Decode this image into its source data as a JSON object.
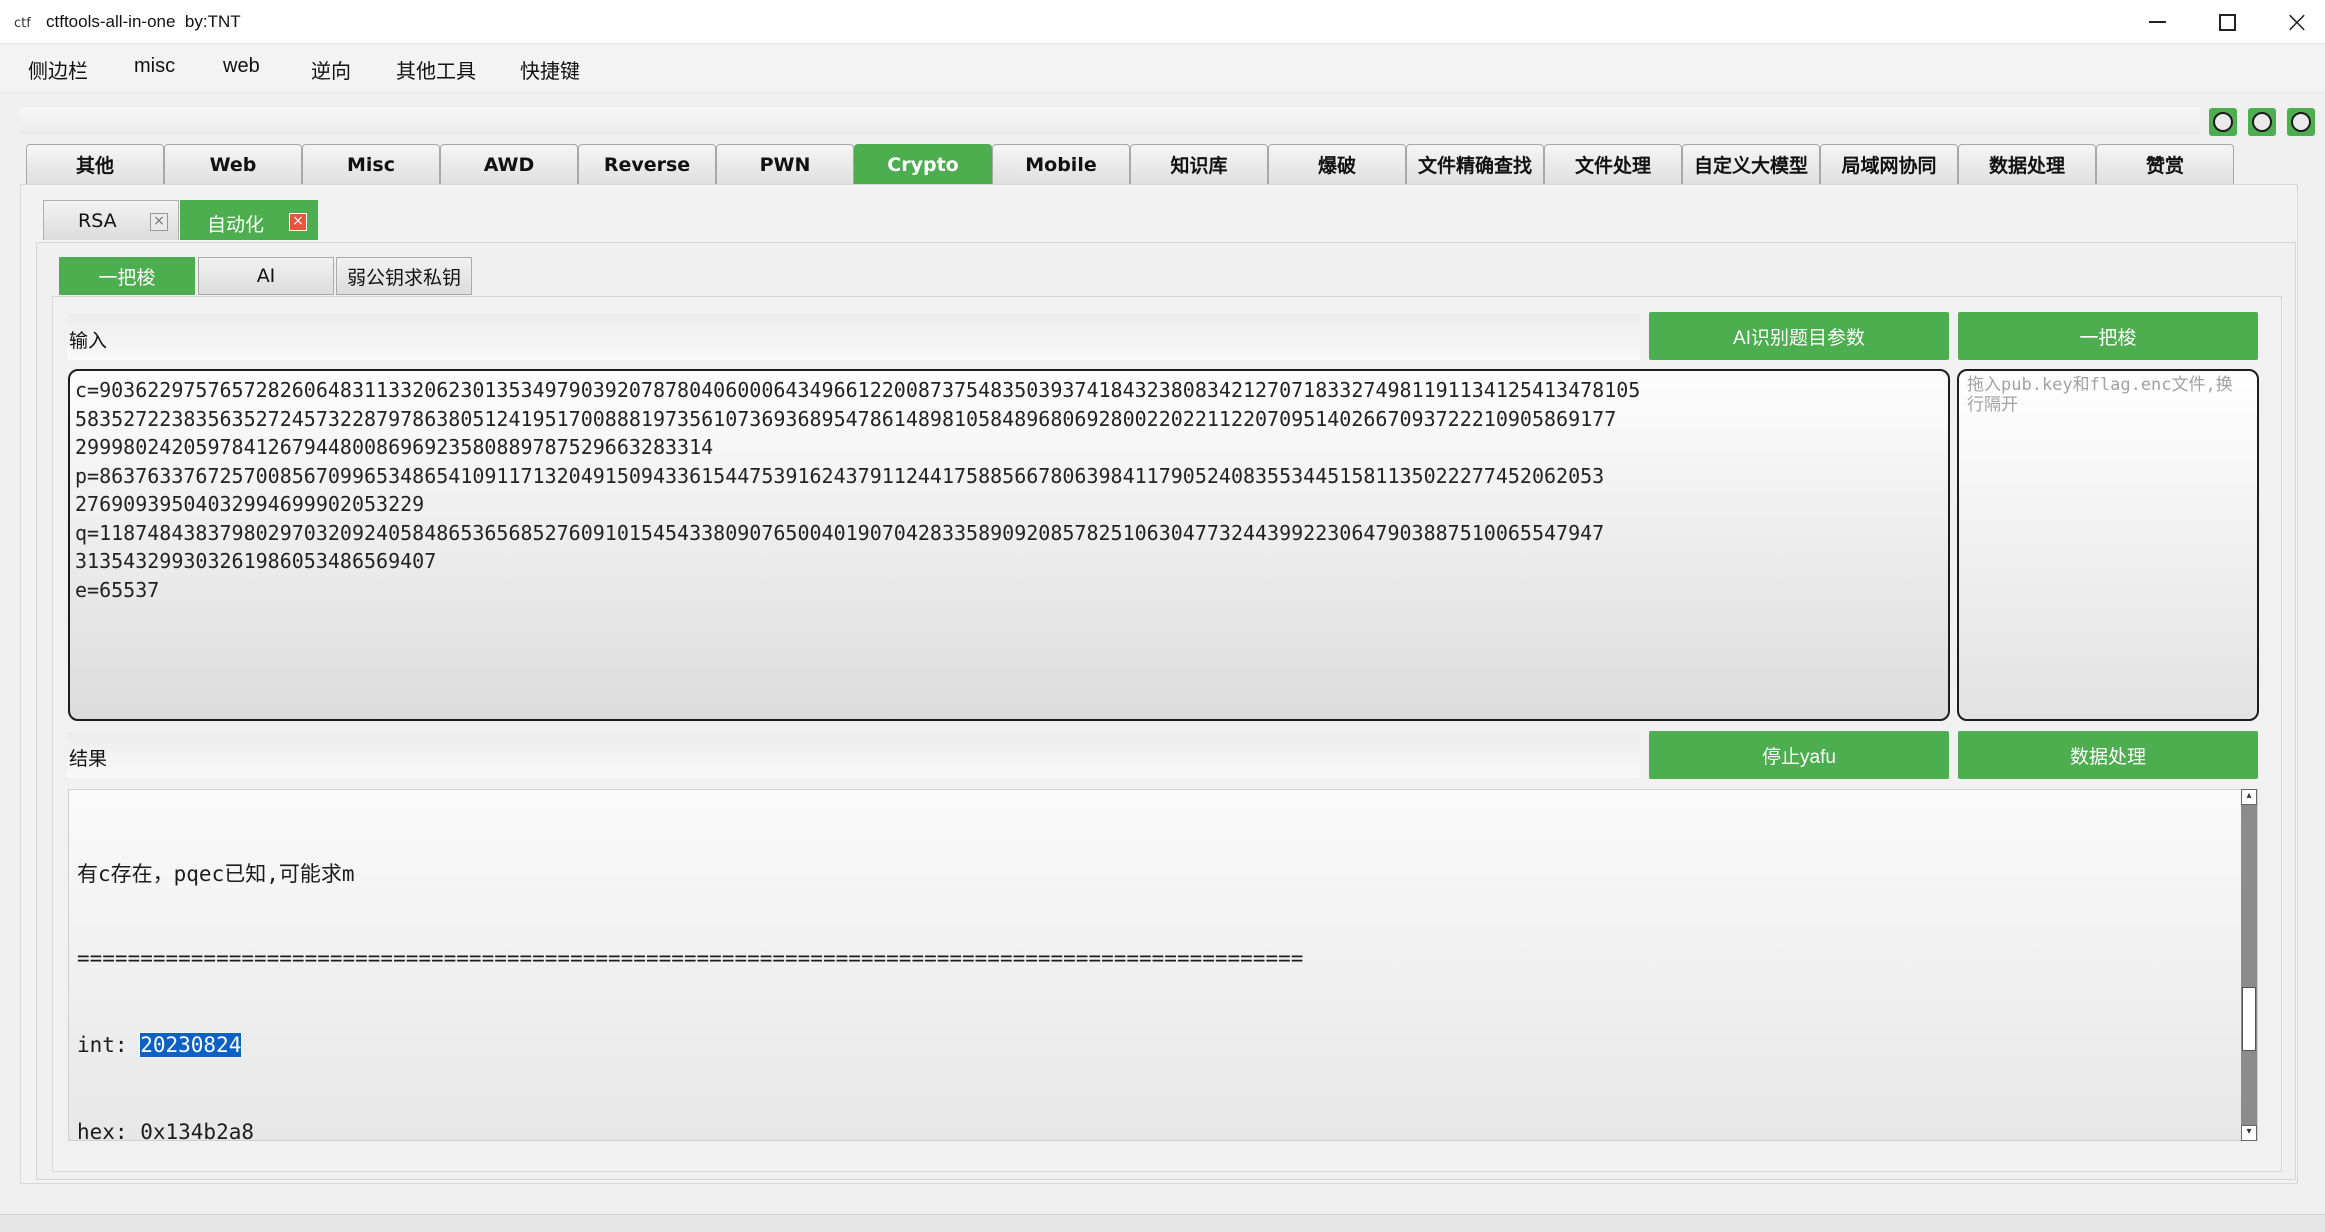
{
  "window": {
    "icon_text": "ctf",
    "title": "ctftools-all-in-one  by:TNT"
  },
  "menu": [
    "侧边栏",
    "misc",
    "web",
    "逆向",
    "其他工具",
    "快捷键"
  ],
  "main_tabs": [
    "其他",
    "Web",
    "Misc",
    "AWD",
    "Reverse",
    "PWN",
    "Crypto",
    "Mobile",
    "知识库",
    "爆破",
    "文件精确查找",
    "文件处理",
    "自定义大模型",
    "局域网协同",
    "数据处理",
    "赞赏"
  ],
  "main_tab_active": "Crypto",
  "sub_tabs": [
    {
      "label": "RSA",
      "close": "×"
    },
    {
      "label": "自动化",
      "close": "×"
    }
  ],
  "mode_tabs": [
    "一把梭",
    "AI",
    "弱公钥求私钥"
  ],
  "input_section": {
    "label": "输入",
    "ai_button": "AI识别题目参数",
    "run_button": "一把梭",
    "lines": [
      "c=90362297576572826064831133206230135349790392078780406000643496612200873754835039374184323808342127071833274981191134125413478105",
      "58352722383563527245732287978638051241951700888197356107369368954786148981058489680692800220221122070951402667093722210905869177",
      "2999802420597841267944800869692358088978752966328331​4",
      "p=86376337672570085670996534865410911713204915094336154475391624379112441758856678063984117905240835534451581135022277452062053",
      "27690939504032994699902053229",
      "q=11874843837980297032092405848653656852760910154543380907650040190704283358909208578251063047732443992230647903887510065547947",
      "31354329930326198605348656940​7",
      "e=65537"
    ],
    "drop_hint": "拖入pub.key和flag.enc文件,换行隔开"
  },
  "result_section": {
    "label": "结果",
    "stop_button": "停止yafu",
    "data_button": "数据处理",
    "lines": [
      "有c存在，pqec已知,可能求m",
      "=================================================================================================",
      "int: ",
      "hex: 0x134b2a8"
    ],
    "selected_value": "20230824"
  },
  "scrollbar": {
    "up": "▴",
    "down": "▾"
  }
}
